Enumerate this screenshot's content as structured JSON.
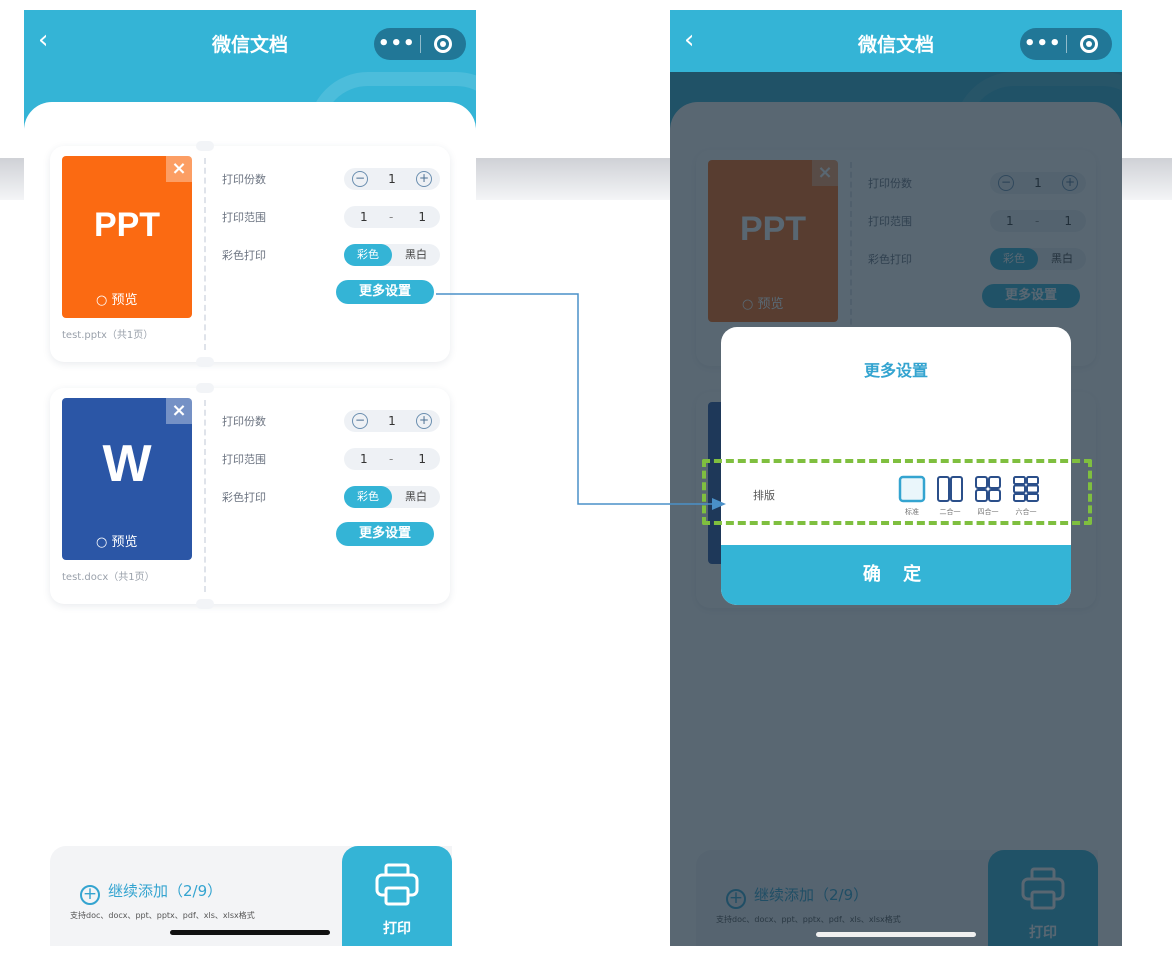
{
  "nav": {
    "back_glyph": "‹",
    "title": "微信文档",
    "more_glyph": "•••"
  },
  "files": [
    {
      "type_label": "PPT",
      "thumb_color": "#fb6a12",
      "close_glyph": "×",
      "preview_label": "预览",
      "file_name": "test.pptx（共1页）",
      "copies_label": "打印份数",
      "copies_value": "1",
      "range_label": "打印范围",
      "range_from": "1",
      "range_dash": "-",
      "range_to": "1",
      "color_label": "彩色打印",
      "color_option": "彩色",
      "bw_option": "黑白",
      "more_button": "更多设置"
    },
    {
      "type_label": "W",
      "thumb_color": "#2b56a6",
      "close_glyph": "×",
      "preview_label": "预览",
      "file_name": "test.docx（共1页）",
      "copies_label": "打印份数",
      "copies_value": "1",
      "range_label": "打印范围",
      "range_from": "1",
      "range_dash": "-",
      "range_to": "1",
      "color_label": "彩色打印",
      "color_option": "彩色",
      "bw_option": "黑白",
      "more_button": "更多设置"
    }
  ],
  "bottom": {
    "add_label": "继续添加",
    "add_count": "（2/9）",
    "formats": "支持doc、docx、ppt、pptx、pdf、xls、xlsx格式",
    "print_label": "打印"
  },
  "modal": {
    "title": "更多设置",
    "layout_label": "排版",
    "layout_options": [
      "标准",
      "二合一",
      "四合一",
      "六合一"
    ],
    "confirm_label": "确 定"
  },
  "colors": {
    "accent": "#34b4d6",
    "highlight": "#7fbf3f",
    "connector": "#4a90c8"
  },
  "icons": [
    "back-icon",
    "more-dots-icon",
    "target-icon",
    "close-icon",
    "search-icon",
    "minus-circle-icon",
    "plus-circle-icon",
    "add-circle-icon",
    "printer-icon"
  ]
}
